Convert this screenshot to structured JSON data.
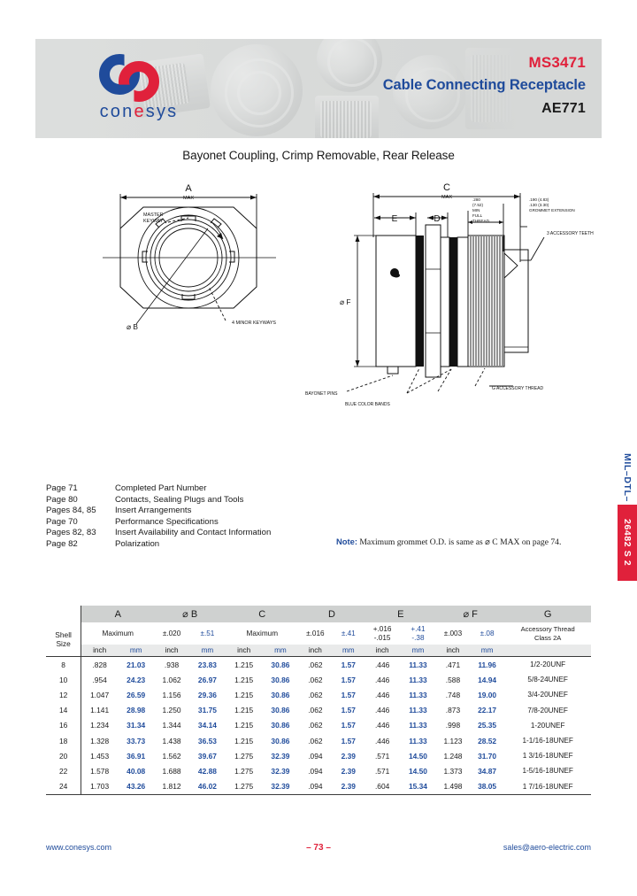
{
  "header": {
    "part_number": "MS3471",
    "product_name": "Cable Connecting Receptacle",
    "series": "AE771",
    "logo_text_1": "con",
    "logo_text_e": "e",
    "logo_text_2": "sys",
    "logo_colors": {
      "blue": "#1f4b9b",
      "red": "#e0213b"
    }
  },
  "subtitle": "Bayonet Coupling, Crimp Removable, Rear Release",
  "drawing": {
    "front_view": {
      "dim_a": "A",
      "dim_a_sub": "MAX",
      "master_keyway": "MASTER KEYWAY",
      "dia_b": "⌀ B",
      "minor_keyways": "4 MINOR KEYWAYS"
    },
    "side_view": {
      "dim_c": "C",
      "dim_c_sub": "MAX",
      "dim_e": "E",
      "dim_d": "D",
      "dia_f": "⌀ F",
      "full_thread": ".280 (7.52) MIN FULL THREAD",
      "grommet_ext": ".190 (4.83) .130 (3.30) GROMMET EXTENSION",
      "accessory_teeth": "3 ACCESSORY TEETH",
      "bayonet_pins": "BAYONET PINS",
      "blue_color_bands": "BLUE COLOR BANDS",
      "accessory_thread": "G ACCESSORY THREAD"
    }
  },
  "references": [
    {
      "page": "Page 71",
      "desc": "Completed Part Number"
    },
    {
      "page": "Page 80",
      "desc": "Contacts, Sealing Plugs and Tools"
    },
    {
      "page": "Pages 84, 85",
      "desc": "Insert Arrangements"
    },
    {
      "page": "Page 70",
      "desc": "Performance Specifications"
    },
    {
      "page": "Pages 82, 83",
      "desc": "Insert Availability and Contact Information"
    },
    {
      "page": "Page 82",
      "desc": "Polarization"
    }
  ],
  "note": {
    "label": "Note:",
    "text": " Maximum grommet O.D. is same as ⌀ C MAX on page 74."
  },
  "side_tab": {
    "upper": "MIL–DTL–",
    "lower": "26482 S 2"
  },
  "table": {
    "shell_label_line1": "Shell",
    "shell_label_line2": "Size",
    "groups": [
      "A",
      "⌀ B",
      "C",
      "D",
      "E",
      "⌀ F",
      "G"
    ],
    "tolerances": {
      "a_inch": "Maximum",
      "a_mm": "Maximum",
      "b_inch": "±.020",
      "b_mm": "±.51",
      "c_inch": "Maximum",
      "c_mm": "Maximum",
      "d_inch": "±.016",
      "d_mm": "±.41",
      "e_inch": "+.016\n-.015",
      "e_inch_1": "+.016",
      "e_inch_2": "-.015",
      "e_mm_1": "+.41",
      "e_mm_2": "-.38",
      "f_inch": "±.003",
      "f_mm": "±.08",
      "g_1": "Accessory Thread",
      "g_2": "Class 2A"
    },
    "unit_inch": "inch",
    "unit_mm": "mm",
    "rows": [
      {
        "shell": "8",
        "a_in": ".828",
        "a_mm": "21.03",
        "b_in": ".938",
        "b_mm": "23.83",
        "c_in": "1.215",
        "c_mm": "30.86",
        "d_in": ".062",
        "d_mm": "1.57",
        "e_in": ".446",
        "e_mm": "11.33",
        "f_in": ".471",
        "f_mm": "11.96",
        "g": "1/2-20UNF"
      },
      {
        "shell": "10",
        "a_in": ".954",
        "a_mm": "24.23",
        "b_in": "1.062",
        "b_mm": "26.97",
        "c_in": "1.215",
        "c_mm": "30.86",
        "d_in": ".062",
        "d_mm": "1.57",
        "e_in": ".446",
        "e_mm": "11.33",
        "f_in": ".588",
        "f_mm": "14.94",
        "g": "5/8-24UNEF"
      },
      {
        "shell": "12",
        "a_in": "1.047",
        "a_mm": "26.59",
        "b_in": "1.156",
        "b_mm": "29.36",
        "c_in": "1.215",
        "c_mm": "30.86",
        "d_in": ".062",
        "d_mm": "1.57",
        "e_in": ".446",
        "e_mm": "11.33",
        "f_in": ".748",
        "f_mm": "19.00",
        "g": "3/4-20UNEF"
      },
      {
        "shell": "14",
        "a_in": "1.141",
        "a_mm": "28.98",
        "b_in": "1.250",
        "b_mm": "31.75",
        "c_in": "1.215",
        "c_mm": "30.86",
        "d_in": ".062",
        "d_mm": "1.57",
        "e_in": ".446",
        "e_mm": "11.33",
        "f_in": ".873",
        "f_mm": "22.17",
        "g": "7/8-20UNEF"
      },
      {
        "shell": "16",
        "a_in": "1.234",
        "a_mm": "31.34",
        "b_in": "1.344",
        "b_mm": "34.14",
        "c_in": "1.215",
        "c_mm": "30.86",
        "d_in": ".062",
        "d_mm": "1.57",
        "e_in": ".446",
        "e_mm": "11.33",
        "f_in": ".998",
        "f_mm": "25.35",
        "g": "1-20UNEF"
      },
      {
        "shell": "18",
        "a_in": "1.328",
        "a_mm": "33.73",
        "b_in": "1.438",
        "b_mm": "36.53",
        "c_in": "1.215",
        "c_mm": "30.86",
        "d_in": ".062",
        "d_mm": "1.57",
        "e_in": ".446",
        "e_mm": "11.33",
        "f_in": "1.123",
        "f_mm": "28.52",
        "g": "1-1/16-18UNEF"
      },
      {
        "shell": "20",
        "a_in": "1.453",
        "a_mm": "36.91",
        "b_in": "1.562",
        "b_mm": "39.67",
        "c_in": "1.275",
        "c_mm": "32.39",
        "d_in": ".094",
        "d_mm": "2.39",
        "e_in": ".571",
        "e_mm": "14.50",
        "f_in": "1.248",
        "f_mm": "31.70",
        "g": "1 3/16-18UNEF"
      },
      {
        "shell": "22",
        "a_in": "1.578",
        "a_mm": "40.08",
        "b_in": "1.688",
        "b_mm": "42.88",
        "c_in": "1.275",
        "c_mm": "32.39",
        "d_in": ".094",
        "d_mm": "2.39",
        "e_in": ".571",
        "e_mm": "14.50",
        "f_in": "1.373",
        "f_mm": "34.87",
        "g": "1-5/16-18UNEF"
      },
      {
        "shell": "24",
        "a_in": "1.703",
        "a_mm": "43.26",
        "b_in": "1.812",
        "b_mm": "46.02",
        "c_in": "1.275",
        "c_mm": "32.39",
        "d_in": ".094",
        "d_mm": "2.39",
        "e_in": ".604",
        "e_mm": "15.34",
        "f_in": "1.498",
        "f_mm": "38.05",
        "g": "1 7/16-18UNEF"
      }
    ]
  },
  "footer": {
    "website": "www.conesys.com",
    "page": "–  73  –",
    "email": "sales@aero-electric.com"
  }
}
